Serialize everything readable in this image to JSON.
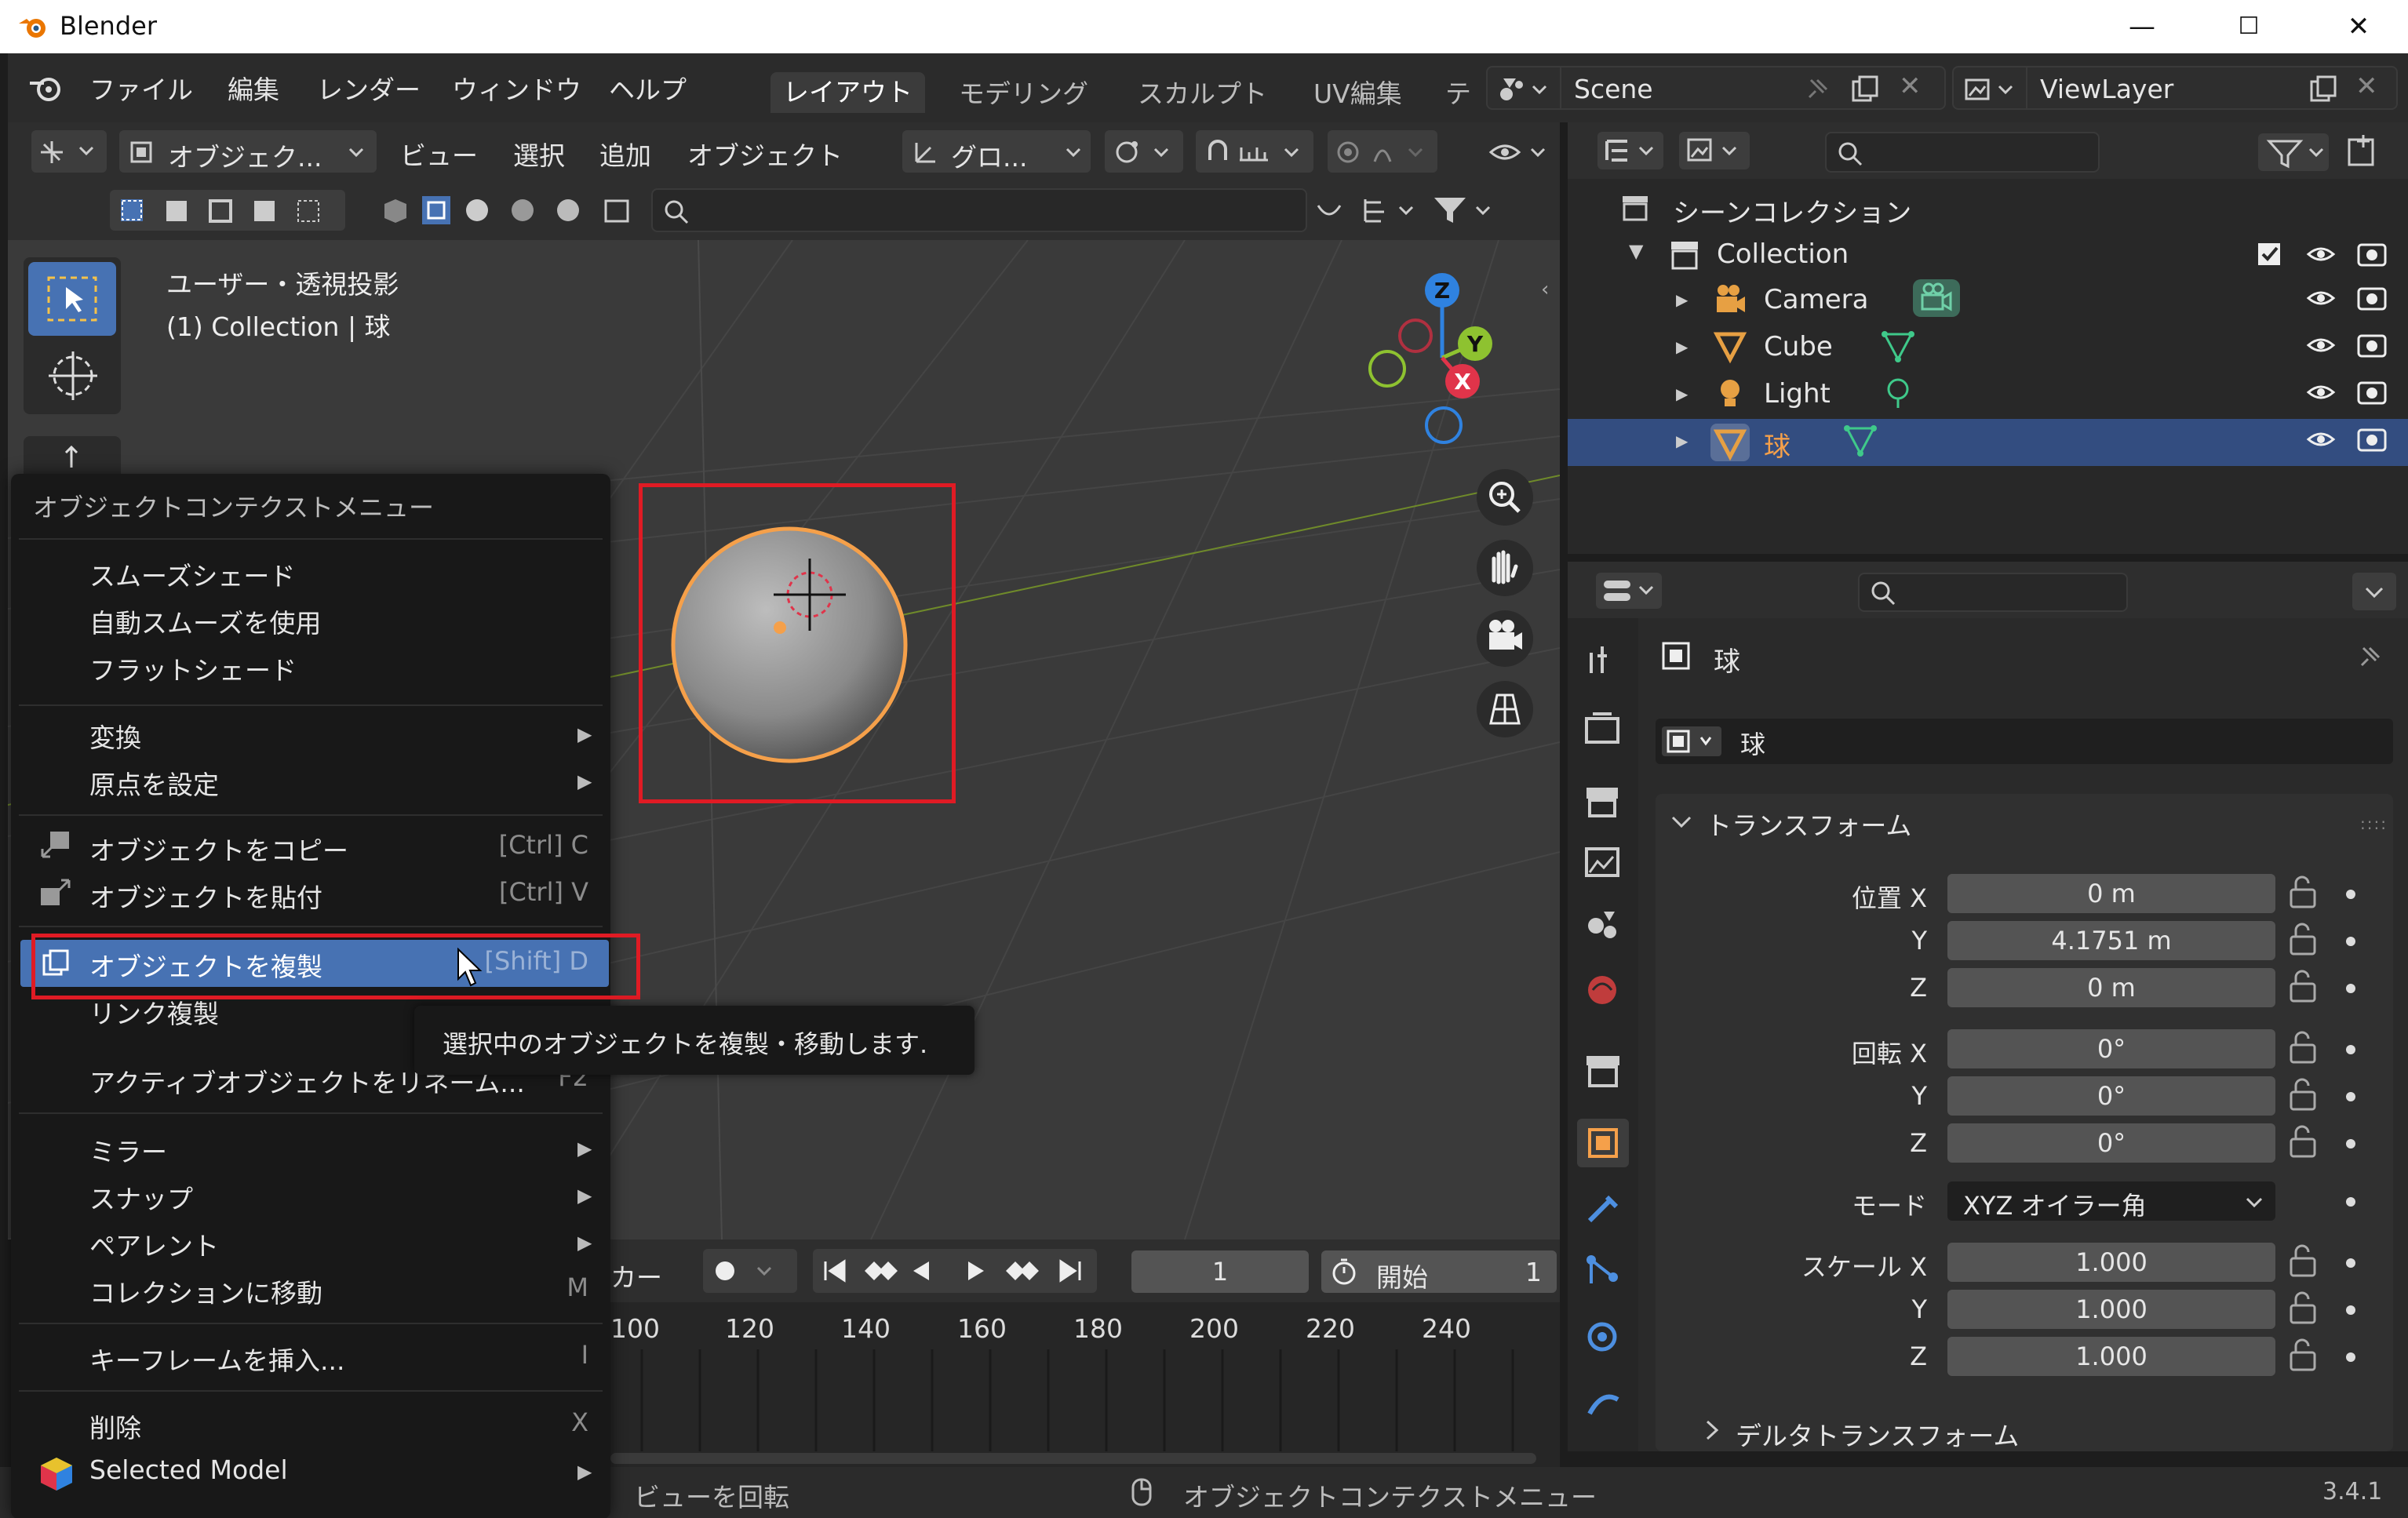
{
  "window": {
    "title": "Blender",
    "minimize": "—",
    "maximize": "☐",
    "close": "✕"
  },
  "menubar": {
    "items": [
      "ファイル",
      "編集",
      "レンダー",
      "ウィンドウ",
      "ヘルプ"
    ],
    "workspaces": [
      "レイアウト",
      "モデリング",
      "スカルプト",
      "UV編集",
      "テ"
    ],
    "active_workspace": "レイアウト",
    "scene": "Scene",
    "view_layer": "ViewLayer"
  },
  "viewport_header": {
    "mode": "オブジェク...",
    "menus": [
      "ビュー",
      "選択",
      "追加",
      "オブジェクト"
    ],
    "transform_orientation": "グロ..."
  },
  "viewport": {
    "view_name": "ユーザー・透視投影",
    "collection_info": "(1) Collection | 球",
    "gizmo_axes": [
      "Z",
      "Y",
      "X"
    ]
  },
  "context_menu": {
    "title": "オブジェクトコンテクストメニュー",
    "groups": [
      [
        {
          "label": "スムーズシェード",
          "shortcut": "",
          "submenu": false
        },
        {
          "label": "自動スムーズを使用",
          "shortcut": "",
          "submenu": false
        },
        {
          "label": "フラットシェード",
          "shortcut": "",
          "submenu": false
        }
      ],
      [
        {
          "label": "変換",
          "shortcut": "",
          "submenu": true
        },
        {
          "label": "原点を設定",
          "shortcut": "",
          "submenu": true
        }
      ],
      [
        {
          "label": "オブジェクトをコピー",
          "shortcut": "[Ctrl] C",
          "submenu": false
        },
        {
          "label": "オブジェクトを貼付",
          "shortcut": "[Ctrl] V",
          "submenu": false
        }
      ],
      [
        {
          "label": "オブジェクトを複製",
          "shortcut": "[Shift] D",
          "submenu": false,
          "highlighted": true
        },
        {
          "label": "リンク複製",
          "shortcut": "",
          "submenu": false
        },
        {
          "label": "アクティブオブジェクトをリネーム...",
          "shortcut": "F2",
          "submenu": false
        }
      ],
      [
        {
          "label": "ミラー",
          "shortcut": "",
          "submenu": true
        },
        {
          "label": "スナップ",
          "shortcut": "",
          "submenu": true
        },
        {
          "label": "ペアレント",
          "shortcut": "",
          "submenu": true
        },
        {
          "label": "コレクションに移動",
          "shortcut": "M",
          "submenu": false
        }
      ],
      [
        {
          "label": "キーフレームを挿入...",
          "shortcut": "I",
          "submenu": false
        }
      ],
      [
        {
          "label": "削除",
          "shortcut": "X",
          "submenu": false
        },
        {
          "label": "Selected Model",
          "shortcut": "",
          "submenu": true
        }
      ]
    ],
    "tooltip": "選択中のオブジェクトを複製・移動します."
  },
  "outliner": {
    "root": "シーンコレクション",
    "collection": "Collection",
    "objects": [
      {
        "name": "Camera",
        "selected": false,
        "color": "#e7a043"
      },
      {
        "name": "Cube",
        "selected": false,
        "color": "#e7a043"
      },
      {
        "name": "Light",
        "selected": false,
        "color": "#e7a043"
      },
      {
        "name": "球",
        "selected": true,
        "color": "#e7a043"
      }
    ]
  },
  "properties": {
    "object_name": "球",
    "mesh_name": "球",
    "panel_title": "トランスフォーム",
    "location": {
      "label": "位置 X",
      "x": "0 m",
      "y": "4.1751 m",
      "z": "0 m"
    },
    "rotation": {
      "label": "回転 X",
      "x": "0°",
      "y": "0°",
      "z": "0°"
    },
    "mode_label": "モード",
    "mode_value": "XYZ オイラー角",
    "scale": {
      "label": "スケール X",
      "x": "1.000",
      "y": "1.000",
      "z": "1.000"
    },
    "axis_y": "Y",
    "axis_z": "Z",
    "delta_panel": "デルタトランスフォーム"
  },
  "timeline": {
    "partial_label": "カー",
    "current_frame": "1",
    "start_label": "開始",
    "start_value": "1",
    "frame_ticks": [
      "100",
      "120",
      "140",
      "160",
      "180",
      "200",
      "220",
      "240"
    ]
  },
  "statusbar": {
    "hint_left": "ビューを回転",
    "hint_center": "オブジェクトコンテクストメニュー",
    "version": "3.4.1"
  },
  "colors": {
    "accent_blue": "#4772b3",
    "selection_orange": "#f5a04a",
    "highlight_red": "#e01b24",
    "axis_x": "#e0344a",
    "axis_y": "#8ec230",
    "axis_z": "#2f82e0"
  }
}
